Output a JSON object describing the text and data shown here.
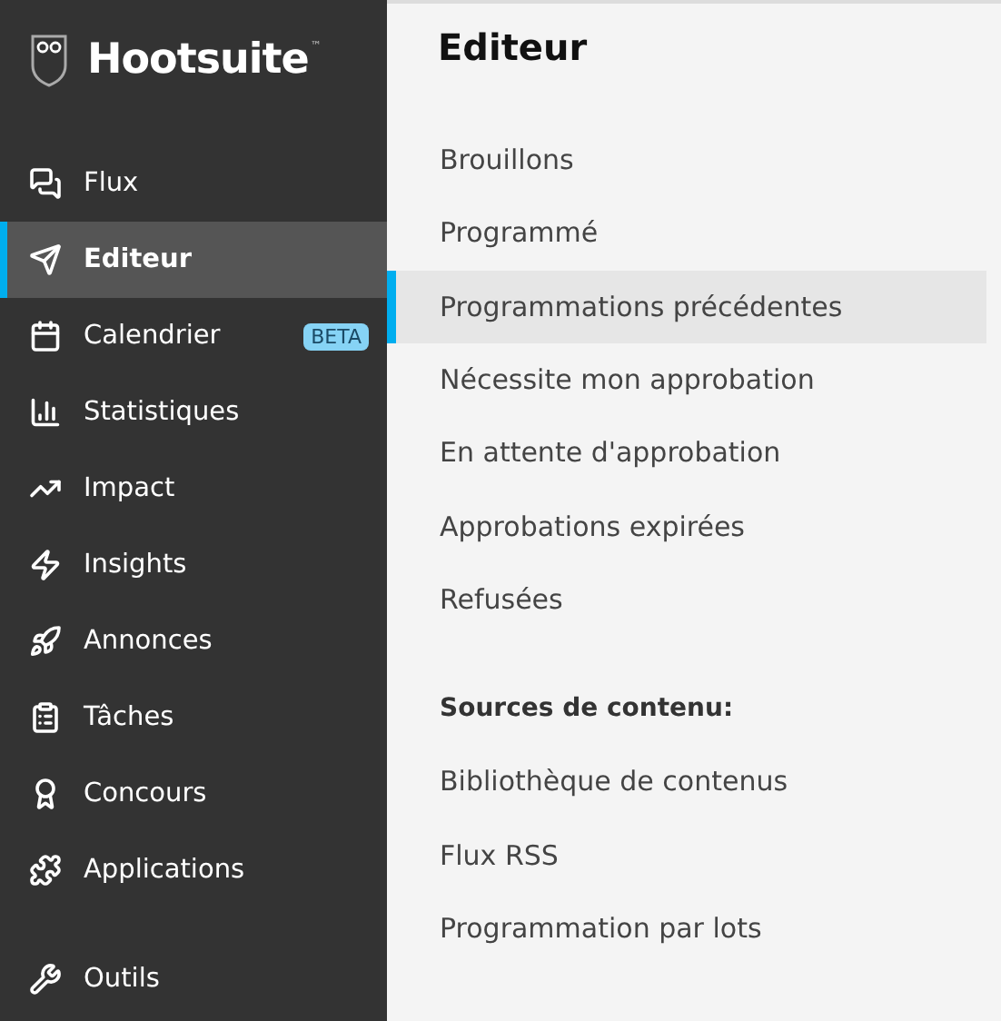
{
  "brand": {
    "name": "Hootsuite",
    "mark": "™"
  },
  "sidebar": {
    "items": [
      {
        "label": "Flux",
        "selected": false
      },
      {
        "label": "Editeur",
        "selected": true
      },
      {
        "label": "Calendrier",
        "selected": false,
        "badge": "BETA"
      },
      {
        "label": "Statistiques",
        "selected": false
      },
      {
        "label": "Impact",
        "selected": false
      },
      {
        "label": "Insights",
        "selected": false
      },
      {
        "label": "Annonces",
        "selected": false
      },
      {
        "label": "Tâches",
        "selected": false
      },
      {
        "label": "Concours",
        "selected": false
      },
      {
        "label": "Applications",
        "selected": false
      }
    ],
    "tools": [
      {
        "label": "Outils",
        "selected": false
      }
    ]
  },
  "panel": {
    "title": "Editeur",
    "items": [
      {
        "label": "Brouillons",
        "selected": false
      },
      {
        "label": "Programmé",
        "selected": false
      },
      {
        "label": "Programmations précédentes",
        "selected": true
      },
      {
        "label": "Nécessite mon approbation",
        "selected": false
      },
      {
        "label": "En attente d'approbation",
        "selected": false
      },
      {
        "label": "Approbations expirées",
        "selected": false
      },
      {
        "label": "Refusées",
        "selected": false
      }
    ],
    "section": {
      "title": "Sources de contenu:",
      "items": [
        {
          "label": "Bibliothèque de contenus",
          "selected": false
        },
        {
          "label": "Flux RSS",
          "selected": false
        },
        {
          "label": "Programmation par lots",
          "selected": false
        }
      ]
    }
  }
}
